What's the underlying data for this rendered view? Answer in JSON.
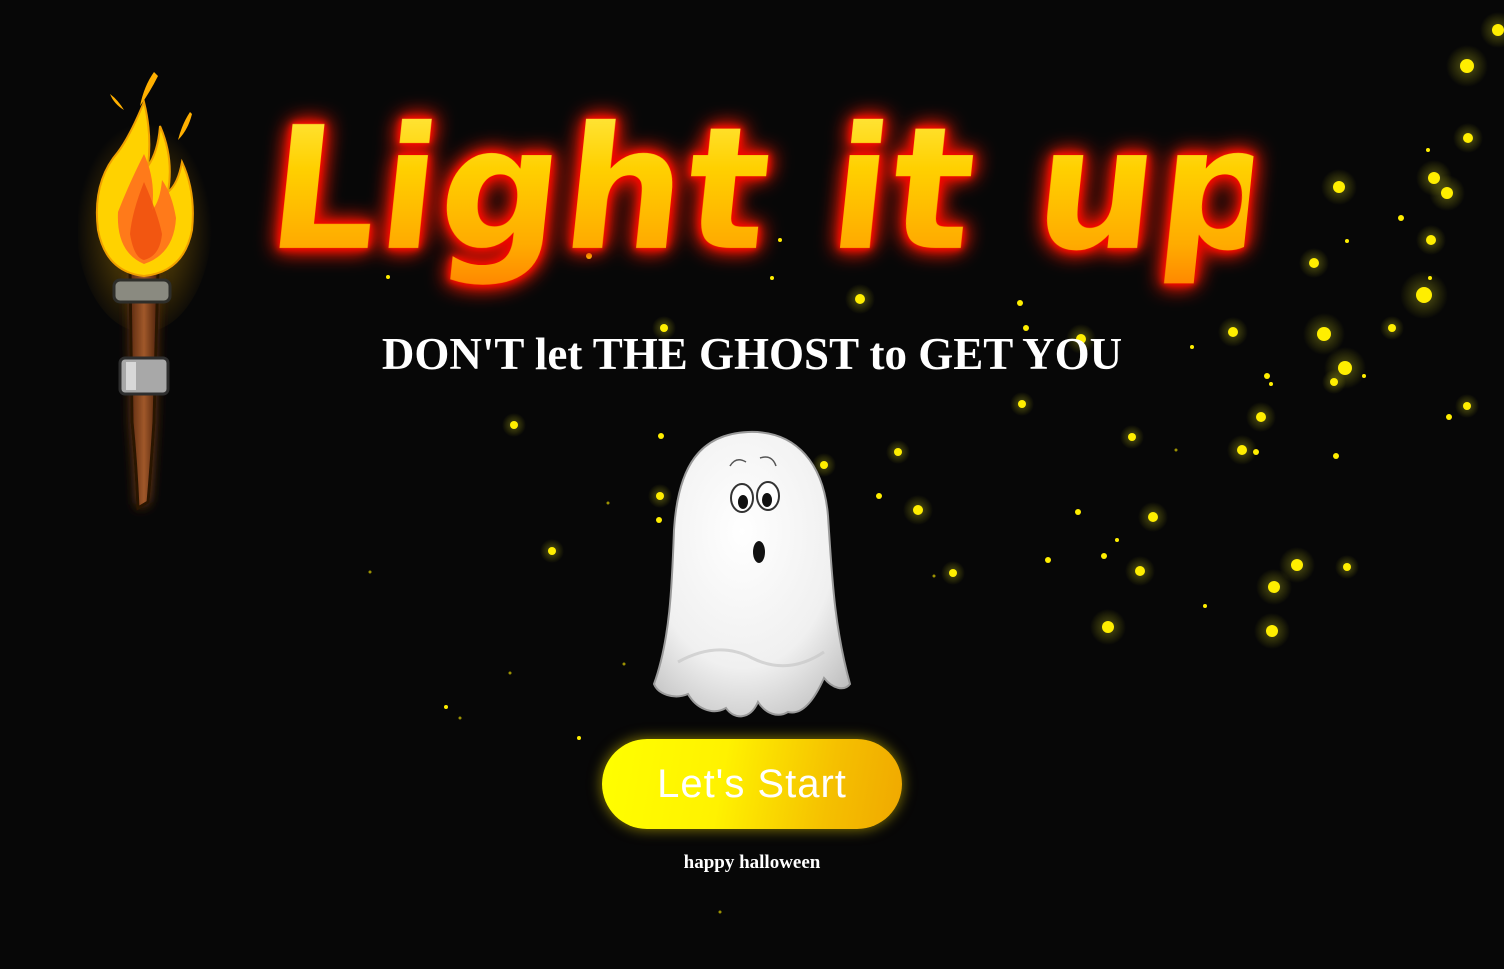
{
  "title": "Light it up",
  "tagline": "DON'T let THE GHOST to GET YOU",
  "start_button_label": "Let's Start",
  "footer_text": "happy halloween",
  "colors": {
    "background": "#070707",
    "particle": "#ffee00",
    "title_fill": "#ffd000",
    "title_glow": "#e00000",
    "button": "#ffee00",
    "text": "#ffffff"
  },
  "icons": {
    "torch": "torch-icon",
    "ghost": "ghost-icon"
  }
}
